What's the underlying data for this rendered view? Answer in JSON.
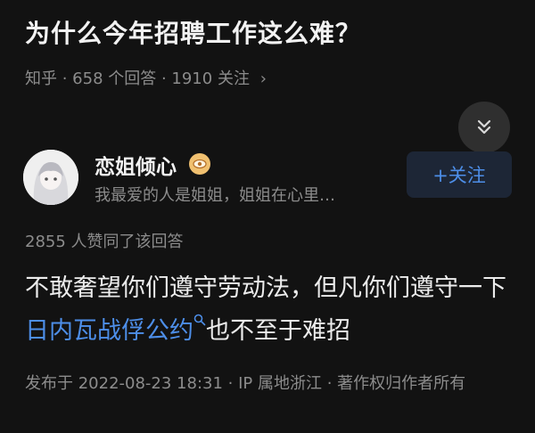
{
  "question": {
    "title": "为什么今年招聘工作这么难？",
    "meta": "知乎 · 658 个回答 · 1910 关注",
    "chevron": "›"
  },
  "collapse_icon": "double-chevron-down-icon",
  "author": {
    "name": "恋姐倾心",
    "bio": "我最爱的人是姐姐，姐姐在心里…",
    "badge_icon": "eye-badge-icon",
    "follow_label": "+关注"
  },
  "answer": {
    "likes": "2855 人赞同了该回答",
    "text_before": "不敢奢望你们遵守劳动法，但凡你们遵守一下",
    "link_text": "日内瓦战俘公约",
    "text_after": "也不至于难招",
    "footer": "发布于 2022-08-23 18:31 · IP 属地浙江 · 著作权归作者所有"
  },
  "colors": {
    "background": "#121212",
    "link": "#4d8ee8",
    "muted": "#8c8c8c"
  }
}
